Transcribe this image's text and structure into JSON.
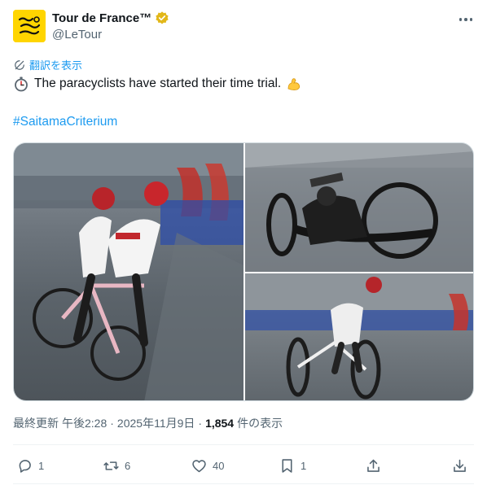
{
  "author": {
    "display_name": "Tour de France™",
    "handle": "@LeTour",
    "avatar_text": "Tour de France"
  },
  "translate_label": "翻訳を表示",
  "tweet": {
    "text": "The paracyclists have started their time trial.",
    "hashtag": "#SaitamaCriterium",
    "lead_emoji": "stopwatch-icon",
    "trail_emoji": "flexed-biceps-icon"
  },
  "meta": {
    "updated_label": "最終更新",
    "time": "午後2:28",
    "separator": "·",
    "date": "2025年11月9日",
    "separator2": "·",
    "views_count": "1,854",
    "views_label": "件の表示"
  },
  "actions": {
    "reply_count": "1",
    "retweet_count": "6",
    "like_count": "40",
    "bookmark_count": "1"
  },
  "colors": {
    "accent": "#1d9bf0",
    "secondary_text": "#536471",
    "avatar_yellow": "#ffd500",
    "verified_gold": "#e2b719"
  }
}
